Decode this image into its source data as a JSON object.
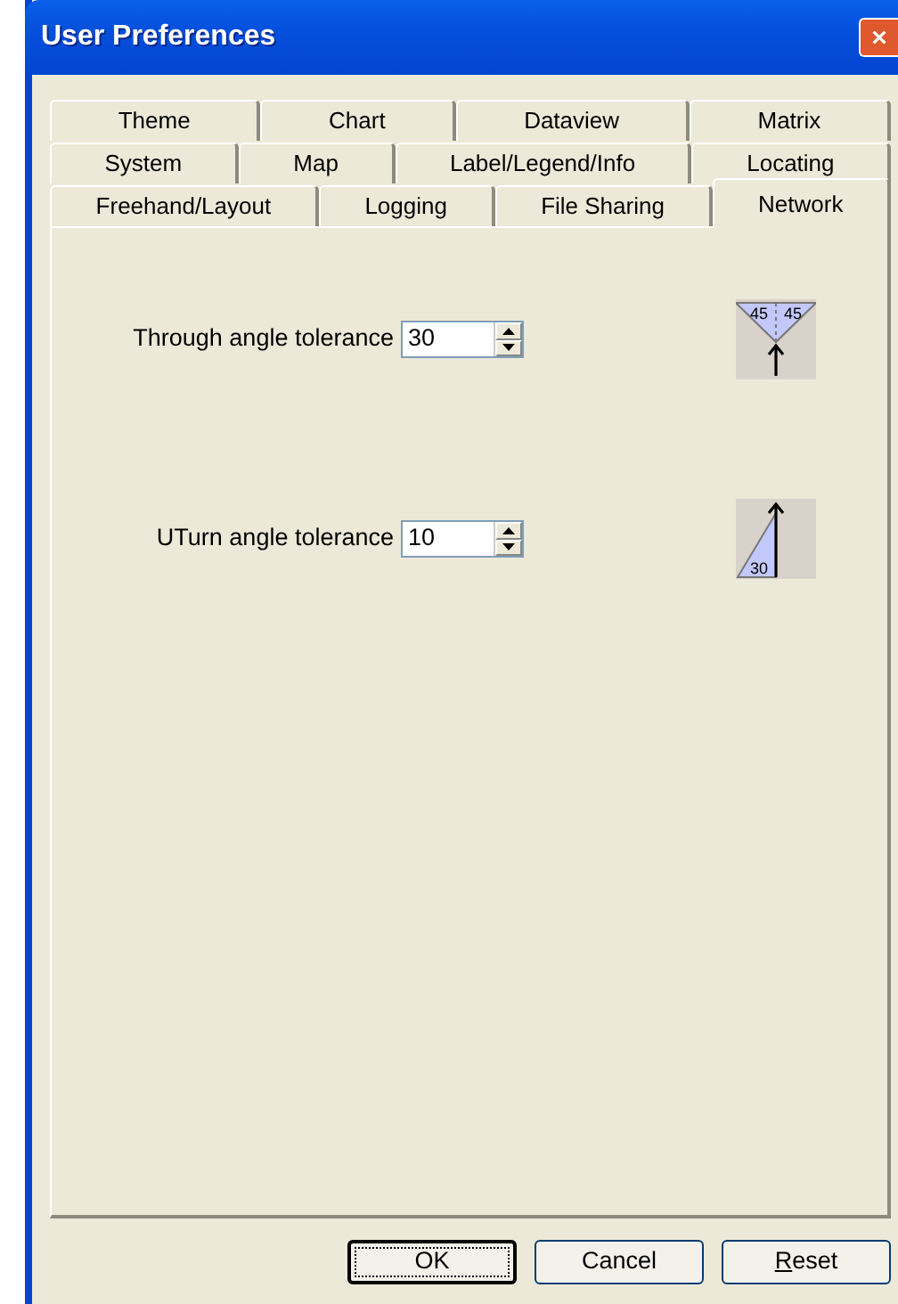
{
  "window": {
    "title": "User Preferences"
  },
  "tab_rows": [
    [
      {
        "label": "Theme",
        "selected": false
      },
      {
        "label": "Chart",
        "selected": false
      },
      {
        "label": "Dataview",
        "selected": false
      },
      {
        "label": "Matrix",
        "selected": false
      }
    ],
    [
      {
        "label": "System",
        "selected": false
      },
      {
        "label": "Map",
        "selected": false
      },
      {
        "label": "Label/Legend/Info",
        "selected": false
      },
      {
        "label": "Locating",
        "selected": false
      }
    ],
    [
      {
        "label": "Freehand/Layout",
        "selected": false
      },
      {
        "label": "Logging",
        "selected": false
      },
      {
        "label": "File Sharing",
        "selected": false
      },
      {
        "label": "Network",
        "selected": true
      }
    ]
  ],
  "settings": [
    {
      "label": "Through angle tolerance",
      "value": "30",
      "diagram": {
        "kind": "through",
        "labels": [
          "45",
          "45"
        ]
      }
    },
    {
      "label": "UTurn angle tolerance",
      "value": "10",
      "diagram": {
        "kind": "uturn",
        "labels": [
          "30"
        ]
      }
    }
  ],
  "buttons": [
    {
      "label": "OK",
      "default": true,
      "underline_first": false
    },
    {
      "label": "Cancel",
      "default": false,
      "underline_first": false
    },
    {
      "label": "Reset",
      "default": false,
      "underline_first": true
    }
  ]
}
